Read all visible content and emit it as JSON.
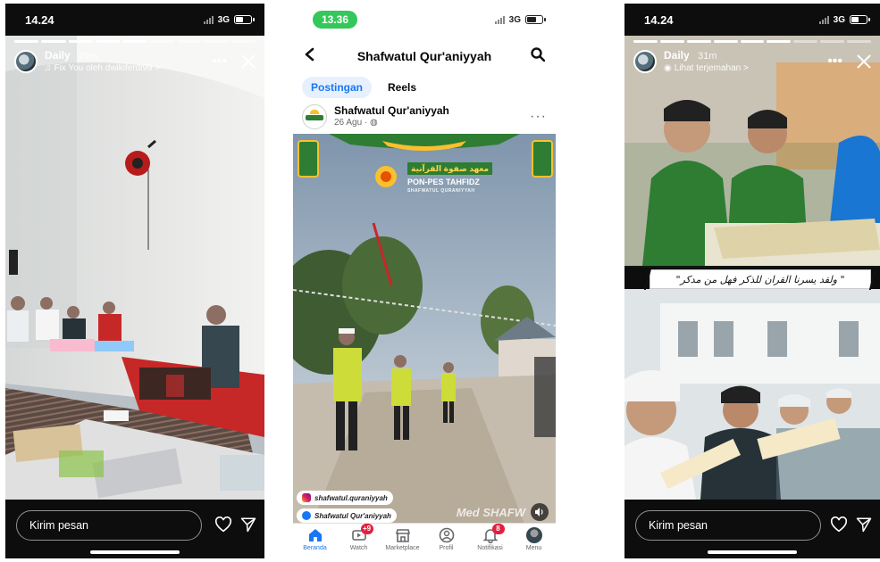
{
  "left_story": {
    "status_time": "14.24",
    "network": "3G",
    "battery_level": 0.5,
    "account_name": "Daily",
    "posted_ago": "29m",
    "music_text": "Fix You oleh dwikiferdi99 >",
    "more_icon": "more-dots-icon",
    "close_icon": "close-icon",
    "reply_placeholder": "Kirim pesan",
    "like_icon": "heart-icon",
    "share_icon": "paper-plane-icon",
    "progress_done": 5,
    "progress_total": 9
  },
  "middle_fb": {
    "status_time": "13.36",
    "network": "3G",
    "battery_level": 0.6,
    "page_title": "Shafwatul Qur'aniyyah",
    "back_icon": "back-chevron-icon",
    "search_icon": "search-icon",
    "tabs": [
      {
        "label": "Postingan",
        "active": true
      },
      {
        "label": "Reels",
        "active": false
      }
    ],
    "post": {
      "author": "Shafwatul Qur'aniyyah",
      "date": "26 Agu · ",
      "more": "···",
      "banner_arabic": "معهد صفوة القرآنية",
      "banner_title": "PON-PES TAHFIDZ",
      "banner_subtitle": "SHAFWATUL QURANIYYAH",
      "ig_handle": "shafwatul.quraniyyah",
      "fb_handle": "Shafwatul Qur'aniyyah",
      "watermark": "Med SHAFW"
    },
    "nav": [
      {
        "label": "Beranda",
        "icon": "home-icon",
        "badge": "",
        "active": true
      },
      {
        "label": "Watch",
        "icon": "video-icon",
        "badge": "+9",
        "active": false
      },
      {
        "label": "Marketplace",
        "icon": "store-icon",
        "badge": "",
        "active": false
      },
      {
        "label": "Profil",
        "icon": "profile-icon",
        "badge": "",
        "active": false
      },
      {
        "label": "Notifikasi",
        "icon": "bell-icon",
        "badge": "8",
        "active": false
      },
      {
        "label": "Menu",
        "icon": "menu-avatar-icon",
        "badge": "",
        "active": false
      }
    ]
  },
  "right_story": {
    "status_time": "14.24",
    "network": "3G",
    "battery_level": 0.5,
    "account_name": "Daily",
    "posted_ago": "31m",
    "translate_text": "Lihat terjemahan >",
    "quote_text": "\"ولقد يسرنا القران للذكر فهل من مدكر \"",
    "reply_placeholder": "Kirim pesan",
    "progress_done": 6,
    "progress_total": 9
  },
  "colors": {
    "fb_blue": "#1877f2",
    "status_green": "#34c759",
    "badge_red": "#e41e3f"
  }
}
